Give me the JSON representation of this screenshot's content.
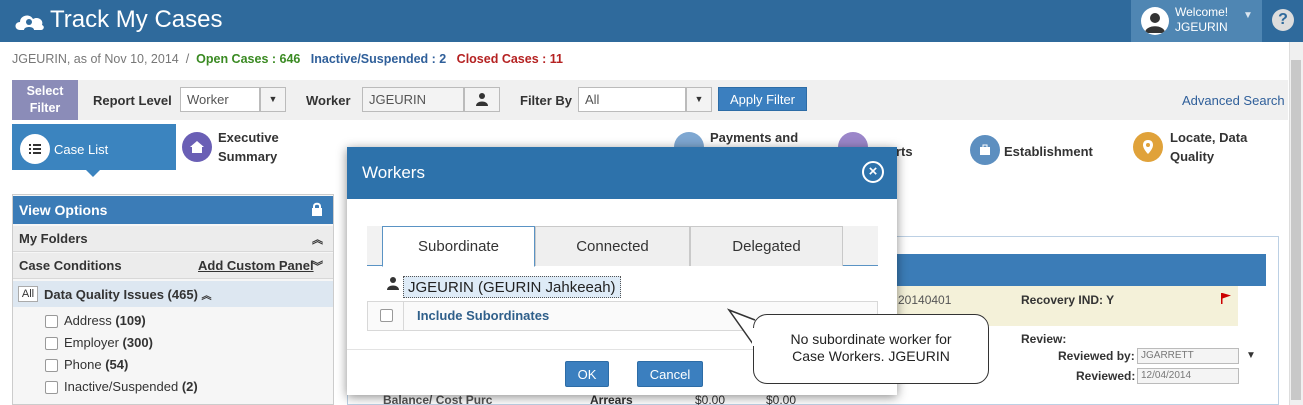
{
  "app": {
    "title": "Track My Cases",
    "welcome": "Welcome!",
    "user": "JGEURIN",
    "help": "?"
  },
  "status": {
    "prefix": "JGEURIN, as of Nov 10, 2014",
    "sep": "/",
    "open": "Open Cases : 646",
    "inactive": "Inactive/Suspended : 2",
    "closed": "Closed Cases : 11"
  },
  "filter": {
    "select_filter_l1": "Select",
    "select_filter_l2": "Filter",
    "report_level_label": "Report Level",
    "report_level_value": "Worker",
    "worker_label": "Worker",
    "worker_value": "JGEURIN",
    "filter_by_label": "Filter By",
    "filter_by_value": "All",
    "apply": "Apply Filter",
    "advanced_search": "Advanced Search"
  },
  "nav": {
    "case_list": "Case List",
    "exec_l1": "Executive",
    "exec_l2": "Summary",
    "payments_l1": "Payments and",
    "reports_frag": "rts",
    "establishment": "Establishment",
    "locate_l1": "Locate, Data",
    "locate_l2": "Quality"
  },
  "left_panel": {
    "view_options": "View Options",
    "my_folders": "My Folders",
    "case_conditions": "Case Conditions",
    "add_custom_panel": "Add Custom Panel",
    "all_badge": "All",
    "dq_issues": "Data Quality Issues (465)",
    "items": [
      {
        "label": "Address",
        "count": "(109)"
      },
      {
        "label": "Employer",
        "count": "(300)"
      },
      {
        "label": "Phone",
        "count": "(54)"
      },
      {
        "label": "Inactive/Suspended",
        "count": "(2)"
      }
    ]
  },
  "background": {
    "case_num_frag": "20140401",
    "recovery": "Recovery IND: Y",
    "review": "Review:",
    "reviewed_by_label": "Reviewed by:",
    "reviewed_by_value": "JGARRETT",
    "reviewed_label": "Reviewed:",
    "reviewed_value": "12/04/2014",
    "arrears": "Arrears",
    "amt1": "$0.00",
    "amt2": "$0.00",
    "balance_frag": "Balance/ Cost Purc"
  },
  "modal": {
    "title": "Workers",
    "tabs": [
      "Subordinate",
      "Connected",
      "Delegated"
    ],
    "worker_name": "JGEURIN (GEURIN Jahkeeah)",
    "include_subordinates": "Include Subordinates",
    "ok": "OK",
    "cancel": "Cancel"
  },
  "callout": {
    "line1": "No subordinate worker for",
    "line2": "Case Workers. JGEURIN"
  },
  "colors": {
    "topbar": "#2f6a9c",
    "accent": "#3b84bf",
    "open": "#3a8a22",
    "inactive": "#2f5f9a",
    "closed": "#b52222"
  }
}
